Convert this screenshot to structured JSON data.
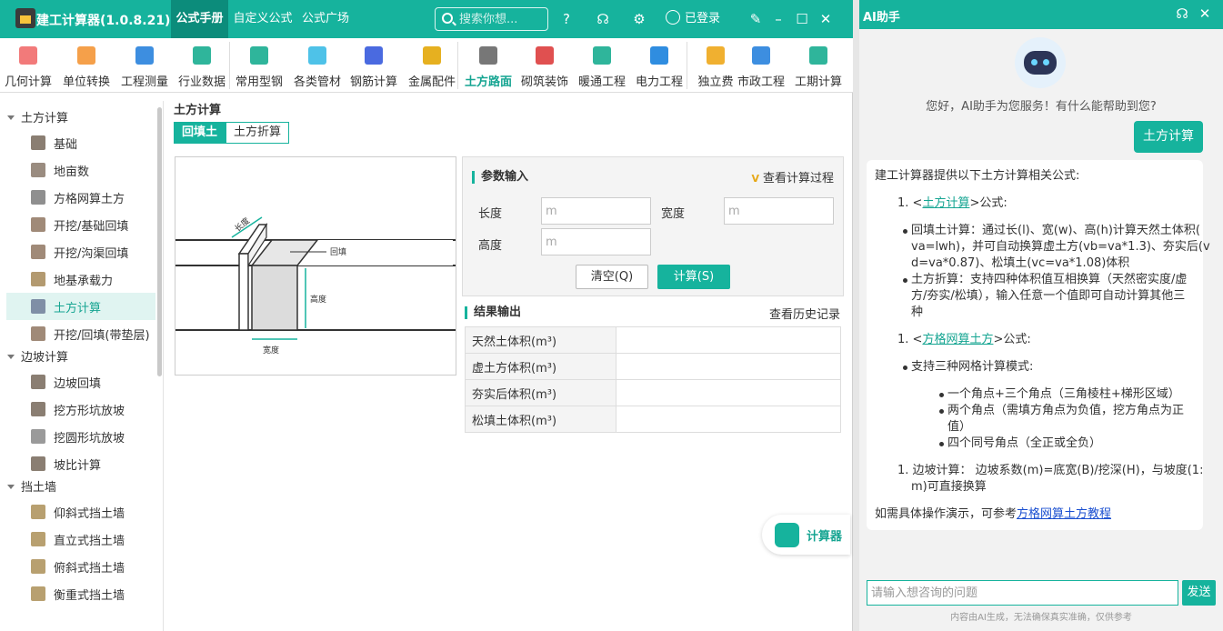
{
  "app": {
    "title": "建工计算器(1.0.8.21)",
    "menu_tabs": [
      "公式手册",
      "自定义公式",
      "公式广场"
    ],
    "search_placeholder": "搜索你想...",
    "login_label": "已登录",
    "accent_color": "#16b39d"
  },
  "toolbar": [
    {
      "label": "几何计算",
      "icon": "cube-icon",
      "color": "#f27a7a"
    },
    {
      "label": "单位转换",
      "icon": "unit-convert-icon",
      "color": "#f5a04a"
    },
    {
      "label": "工程测量",
      "icon": "measure-icon",
      "color": "#3d8ee0"
    },
    {
      "label": "行业数据",
      "icon": "bar-chart-icon",
      "color": "#2fb59b"
    },
    {
      "label": "常用型钢",
      "icon": "wrench-icon",
      "color": "#2fb59b"
    },
    {
      "label": "各类管材",
      "icon": "pipe-icon",
      "color": "#4ec2e8"
    },
    {
      "label": "钢筋计算",
      "icon": "rebar-icon",
      "color": "#4a6ae0"
    },
    {
      "label": "金属配件",
      "icon": "metal-part-icon",
      "color": "#e6b020"
    },
    {
      "label": "土方路面",
      "icon": "road-icon",
      "color": "#777777"
    },
    {
      "label": "砌筑装饰",
      "icon": "brick-icon",
      "color": "#e05050"
    },
    {
      "label": "暖通工程",
      "icon": "fan-icon",
      "color": "#2fb59b"
    },
    {
      "label": "电力工程",
      "icon": "power-house-icon",
      "color": "#2f8de0"
    },
    {
      "label": "独立费",
      "icon": "fee-chart-icon",
      "color": "#f0b030"
    },
    {
      "label": "市政工程",
      "icon": "municipal-icon",
      "color": "#3d8ee0"
    },
    {
      "label": "工期计算",
      "icon": "calendar-icon",
      "color": "#2fb59b"
    }
  ],
  "sidebar": {
    "groups": [
      {
        "label": "土方计算",
        "items": [
          "基础",
          "地亩数",
          "方格网算土方",
          "开挖/基础回填",
          "开挖/沟渠回填",
          "地基承载力",
          "土方计算",
          "开挖/回填(带垫层)"
        ]
      },
      {
        "label": "边坡计算",
        "items": [
          "边坡回填",
          "挖方形坑放坡",
          "挖圆形坑放坡",
          "坡比计算"
        ]
      },
      {
        "label": "挡土墙",
        "items": [
          "仰斜式挡土墙",
          "直立式挡土墙",
          "俯斜式挡土墙",
          "衡重式挡土墙"
        ]
      }
    ]
  },
  "main": {
    "page_title": "土方计算",
    "subtabs": [
      "回填土",
      "土方折算"
    ],
    "diagram_labels": {
      "length": "长度",
      "backfill": "回填",
      "height": "高度",
      "width": "宽度"
    },
    "params_title": "参数输入",
    "view_process": "查看计算过程",
    "fields": [
      {
        "label": "长度",
        "placeholder": "m"
      },
      {
        "label": "宽度",
        "placeholder": "m"
      },
      {
        "label": "高度",
        "placeholder": "m"
      }
    ],
    "clear_label": "清空(Q)",
    "calc_label": "计算(S)",
    "results_title": "结果输出",
    "history_link": "查看历史记录",
    "results": [
      {
        "label": "天然土体积(m³)",
        "value": ""
      },
      {
        "label": "虚土方体积(m³)",
        "value": ""
      },
      {
        "label": "夯实后体积(m³)",
        "value": ""
      },
      {
        "label": "松填土体积(m³)",
        "value": ""
      }
    ],
    "fab_label": "计算器"
  },
  "ai": {
    "title": "AI助手",
    "greeting": "您好，AI助手为您服务！有什么能帮助到您?",
    "user_message": "土方计算",
    "answer": {
      "intro": "建工计算器提供以下土方计算相关公式:",
      "s1_num": "1. <",
      "s1_link": "土方计算",
      "s1_suffix": ">公式:",
      "b1_l1": "回填土计算：通过长(l)、宽(w)、高(h)计算天然土体积(",
      "b1_l2": "va=lwh)，并可自动换算虚土方(vb=va*1.3)、夯实后(v",
      "b1_l3": "d=va*0.87)、松填土(vc=va*1.08)体积",
      "b2_l1": "土方折算：支持四种体积值互相换算（天然密实度/虚",
      "b2_l2": "方/夯实/松填），输入任意一个值即可自动计算其他三",
      "b2_l3": "种",
      "s2_num": "1. <",
      "s2_link": "方格网算土方",
      "s2_suffix": ">公式:",
      "b3": "支持三种网格计算模式:",
      "sb1": "一个角点+三个角点（三角棱柱+梯形区域）",
      "sb2_l1": "两个角点（需填方角点为负值，挖方角点为正",
      "sb2_l2": "值）",
      "sb3": "四个同号角点（全正或全负）",
      "s3_l1": "1. 边坡计算： 边坡系数(m)=底宽(B)/挖深(H)，与坡度(1:",
      "s3_l2": "m)可直接换算",
      "outro": "如需具体操作演示，可参考",
      "outro_link": "方格网算土方教程"
    },
    "input_placeholder": "请输入想咨询的问题",
    "send_label": "发送",
    "disclaimer": "内容由AI生成，无法确保真实准确，仅供参考"
  }
}
